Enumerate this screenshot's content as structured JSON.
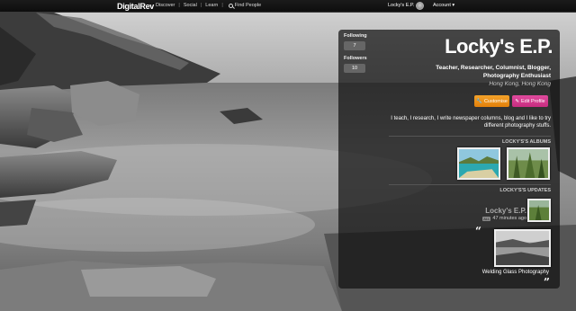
{
  "topbar": {
    "logo": "DigitalRev",
    "nav": [
      "Discover",
      "Social",
      "Learn"
    ],
    "find_people": "Find People",
    "user_name": "Locky's E.P.",
    "account": "Account ▾"
  },
  "profile": {
    "following_label": "Following",
    "following_count": "7",
    "followers_label": "Followers",
    "followers_count": "10",
    "name": "Locky's E.P.",
    "roles": "Teacher,  Researcher,  Columnist,  Blogger,  Photography Enthusiast",
    "location": "Hong Kong, Hong Kong",
    "customise_label": "Customise",
    "edit_profile_label": "Edit Profile",
    "bio": "I teach, I research, I write newspaper columns, blog and I like to try different photography stuffs.",
    "albums_heading": "LOCKY'S'S ALBUMS",
    "updates_heading": "LOCKY'S'S UPDATES",
    "update": {
      "author": "Locky's E.P.",
      "tag": "ALL",
      "time": "47 minutes ago",
      "caption": "Welding Glass Photography"
    }
  },
  "quotes": {
    "open": "“",
    "close": "”"
  }
}
